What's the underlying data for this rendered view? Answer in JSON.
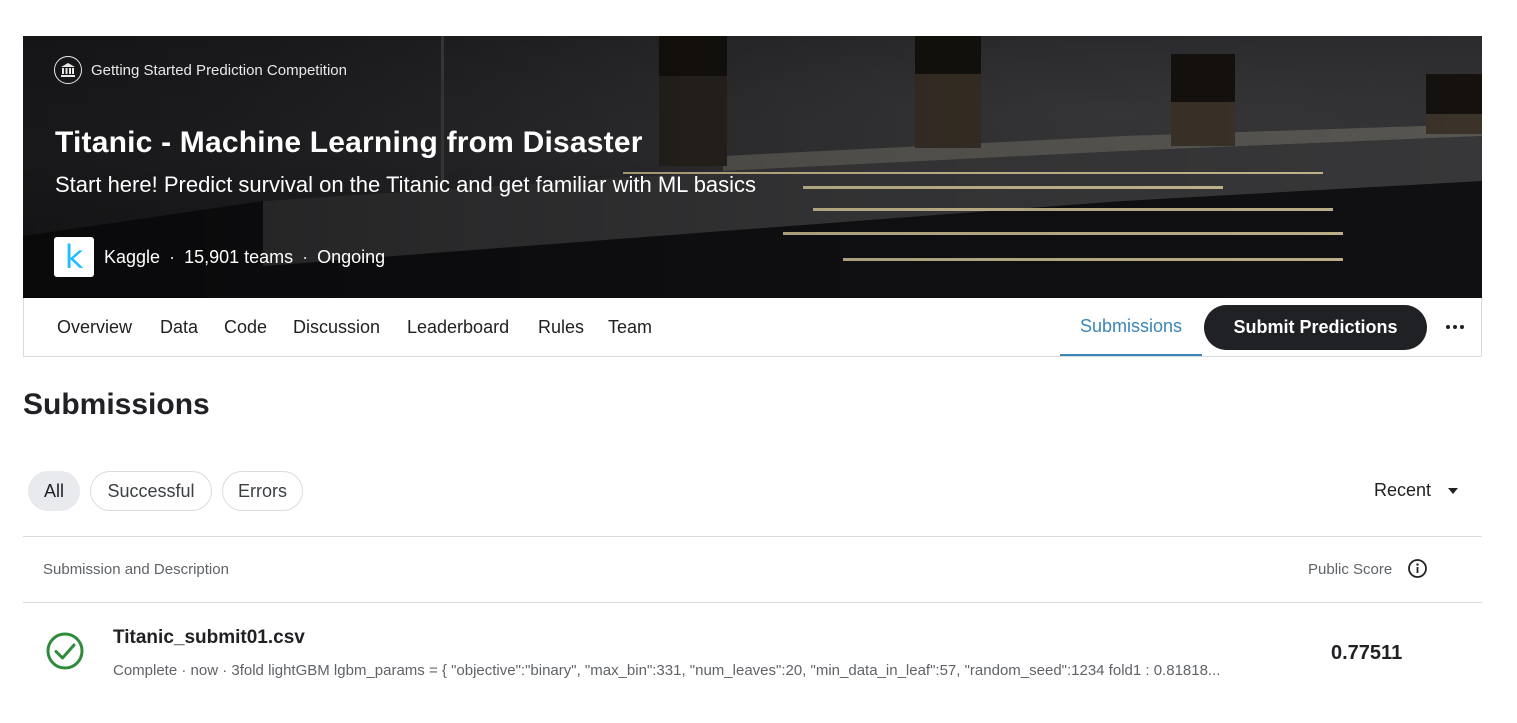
{
  "header": {
    "competition_type": "Getting Started Prediction Competition",
    "title": "Titanic - Machine Learning from Disaster",
    "subtitle": "Start here! Predict survival on the Titanic and get familiar with ML basics",
    "host": "Kaggle",
    "teams": "15,901 teams",
    "status": "Ongoing",
    "separator": "·",
    "logo_letter": "k"
  },
  "tabs": {
    "items": [
      "Overview",
      "Data",
      "Code",
      "Discussion",
      "Leaderboard",
      "Rules",
      "Team"
    ],
    "submissions": "Submissions",
    "submit_label": "Submit Predictions"
  },
  "page": {
    "title": "Submissions"
  },
  "filters": {
    "chips": [
      "All",
      "Successful",
      "Errors"
    ],
    "selected": "All",
    "sort_label": "Recent"
  },
  "table": {
    "col_submission": "Submission and Description",
    "col_score": "Public Score",
    "rows": [
      {
        "filename": "Titanic_submit01.csv",
        "description": "Complete · now · 3fold lightGBM lgbm_params = { \"objective\":\"binary\", \"max_bin\":331, \"num_leaves\":20, \"min_data_in_leaf\":57, \"random_seed\":1234 fold1 : 0.81818...",
        "score": "0.77511",
        "status": "success"
      }
    ]
  },
  "colors": {
    "accent": "#3a86b6",
    "success": "#2e8b3a",
    "kaggle_blue": "#20beff",
    "dark_button": "#202124"
  },
  "icons": {
    "competition_type": "bank-icon",
    "info": "info-icon",
    "status": "check-circle-icon",
    "more": "more-horizontal-icon",
    "sort": "caret-down-icon"
  }
}
